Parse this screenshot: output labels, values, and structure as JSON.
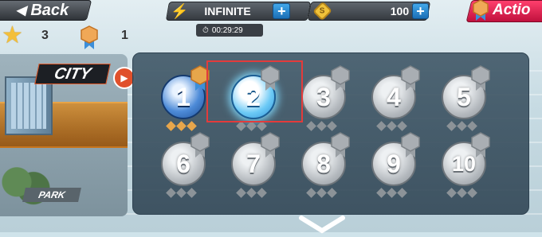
{
  "topbar": {
    "back_label": "Back",
    "energy": {
      "value": "INFINITE",
      "icon": "lightning-icon"
    },
    "timer": "00:29:29",
    "coins": {
      "value": "100",
      "icon": "coin-icon"
    },
    "action_label": "Actio",
    "plus_symbol": "+"
  },
  "stats": {
    "stars": "3",
    "medals": "1"
  },
  "world": {
    "current": "CITY",
    "next": "PARK"
  },
  "levels": [
    {
      "num": "1",
      "state": "completed",
      "medal": "gold",
      "diamonds": [
        "gold",
        "gold",
        "gold"
      ]
    },
    {
      "num": "2",
      "state": "current",
      "medal": "grey",
      "diamonds": [
        "grey",
        "grey",
        "grey"
      ]
    },
    {
      "num": "3",
      "state": "locked",
      "medal": "grey",
      "diamonds": [
        "grey",
        "grey",
        "grey"
      ]
    },
    {
      "num": "4",
      "state": "locked",
      "medal": "grey",
      "diamonds": [
        "grey",
        "grey",
        "grey"
      ]
    },
    {
      "num": "5",
      "state": "locked",
      "medal": "grey",
      "diamonds": [
        "grey",
        "grey",
        "grey"
      ]
    },
    {
      "num": "6",
      "state": "locked",
      "medal": "grey",
      "diamonds": [
        "grey",
        "grey",
        "grey"
      ]
    },
    {
      "num": "7",
      "state": "locked",
      "medal": "grey",
      "diamonds": [
        "grey",
        "grey",
        "grey"
      ]
    },
    {
      "num": "8",
      "state": "locked",
      "medal": "grey",
      "diamonds": [
        "grey",
        "grey",
        "grey"
      ]
    },
    {
      "num": "9",
      "state": "locked",
      "medal": "grey",
      "diamonds": [
        "grey",
        "grey",
        "grey"
      ]
    },
    {
      "num": "10",
      "state": "locked",
      "medal": "grey",
      "diamonds": [
        "grey",
        "grey",
        "grey"
      ]
    }
  ],
  "colors": {
    "gold": "#e7a64b",
    "grey": "#8c9398",
    "accent_blue": "#2f8ed3",
    "action_red": "#e0234f"
  }
}
